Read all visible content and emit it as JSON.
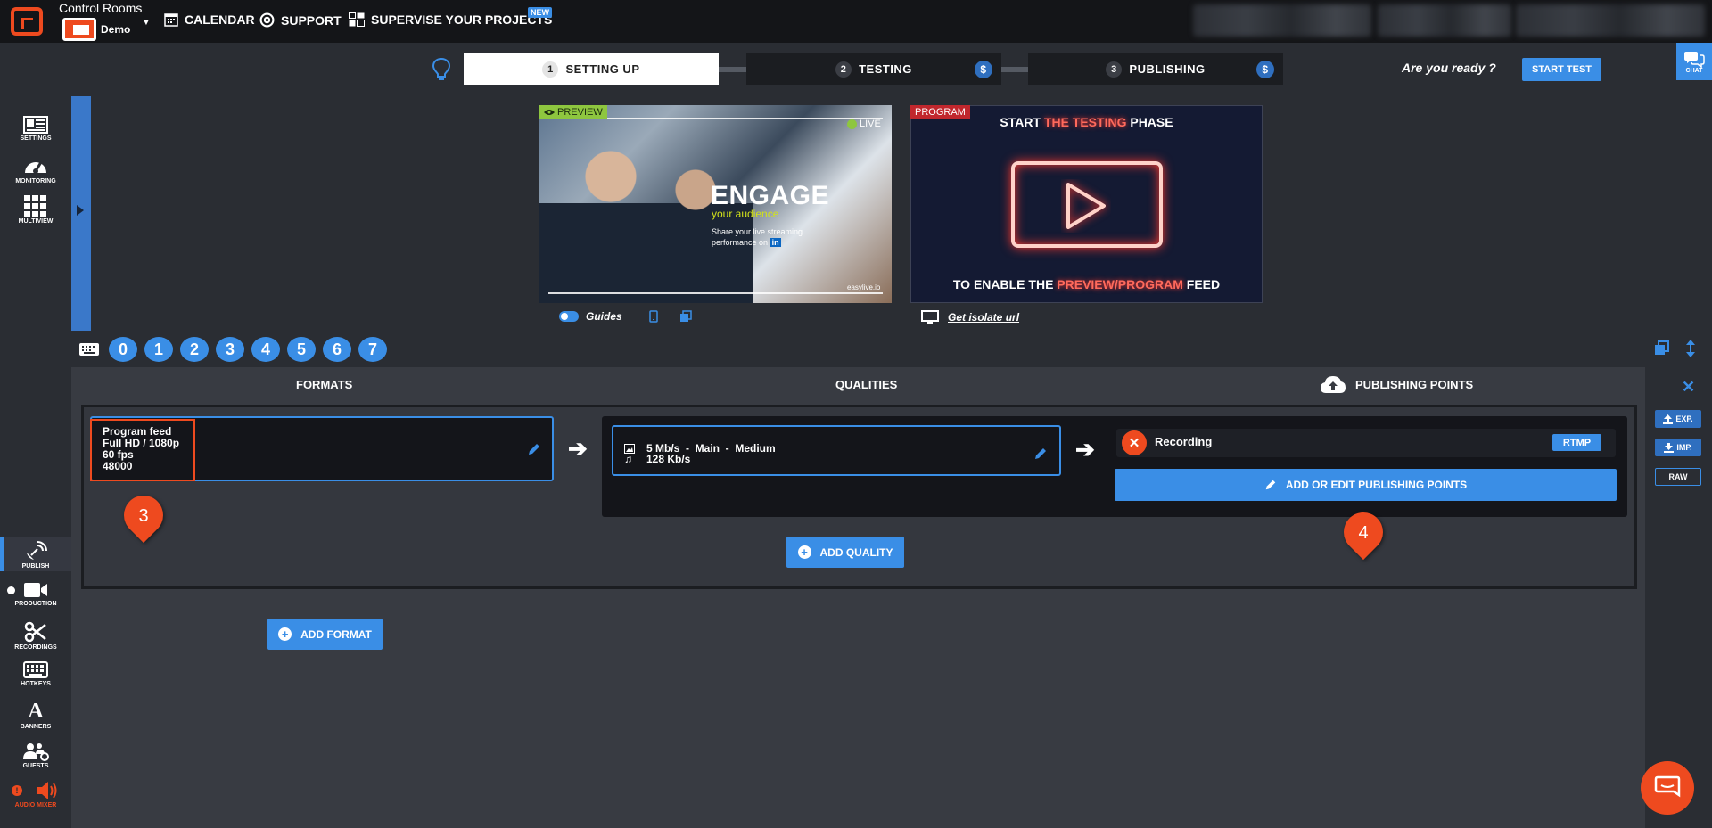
{
  "header": {
    "app_title": "Control Rooms",
    "project": "Demo",
    "nav": [
      {
        "label": "CALENDAR",
        "icon": "calendar-icon"
      },
      {
        "label": "SUPPORT",
        "icon": "lifebuoy-icon"
      },
      {
        "label": "SUPERVISE YOUR PROJECTS",
        "icon": "grid-icon"
      }
    ],
    "new_badge": "NEW"
  },
  "steps": [
    {
      "num": "1",
      "label": "SETTING UP",
      "active": true
    },
    {
      "num": "2",
      "label": "TESTING",
      "price": "$"
    },
    {
      "num": "3",
      "label": "PUBLISHING",
      "price": "$"
    }
  ],
  "ready_text": "Are you ready ?",
  "start_test_label": "START TEST",
  "chat_label": "CHAT",
  "sidebar_top": [
    {
      "label": "SETTINGS",
      "icon": "settings-icon"
    },
    {
      "label": "MONITORING",
      "icon": "gauge-icon"
    },
    {
      "label": "MULTIVIEW",
      "icon": "multiview-icon"
    }
  ],
  "sidebar_bottom": [
    {
      "label": "PUBLISH",
      "icon": "satellite-icon",
      "active": true
    },
    {
      "label": "PRODUCTION",
      "icon": "camera-icon"
    },
    {
      "label": "RECORDINGS",
      "icon": "scissors-icon"
    },
    {
      "label": "HOTKEYS",
      "icon": "keyboard-icon"
    },
    {
      "label": "BANNERS",
      "icon": "letter-a-icon"
    },
    {
      "label": "GUESTS",
      "icon": "guests-icon"
    },
    {
      "label": "AUDIO MIXER",
      "icon": "speaker-icon",
      "alert": true
    }
  ],
  "preview": {
    "tag": "PREVIEW",
    "live": "LIVE",
    "headline": "ENGAGE",
    "subhead": "your audience",
    "body": "Share your live streaming performance on",
    "linkedin": "in",
    "brand": "easylive.io"
  },
  "program": {
    "tag": "PROGRAM",
    "top_line_a": "START ",
    "top_line_b": "THE TESTING",
    "top_line_c": " PHASE",
    "bottom_line_a": "TO ENABLE THE ",
    "bottom_line_b": "PREVIEW/PROGRAM",
    "bottom_line_c": " FEED"
  },
  "guides_label": "Guides",
  "isolate_label": "Get isolate url",
  "hotkeys": [
    "0",
    "1",
    "2",
    "3",
    "4",
    "5",
    "6",
    "7"
  ],
  "columns": {
    "formats": "FORMATS",
    "qualities": "QUALITIES",
    "publishing_points": "PUBLISHING POINTS"
  },
  "format": {
    "name": "Program feed",
    "resolution": "Full HD / 1080p",
    "fps": "60 fps",
    "sample_rate": "48000"
  },
  "quality": {
    "video": "5 Mb/s  -  Main  -  Medium",
    "audio": "128 Kb/s"
  },
  "publishing_point": {
    "name": "Recording",
    "protocol": "RTMP"
  },
  "buttons": {
    "add_edit_pub": "ADD OR EDIT PUBLISHING POINTS",
    "add_quality": "ADD QUALITY",
    "add_format": "ADD FORMAT",
    "exp": "EXP.",
    "imp": "IMP.",
    "raw": "RAW"
  },
  "markers": [
    "3",
    "4"
  ],
  "colors": {
    "accent": "#3a8ee6",
    "brand": "#ee4a1f",
    "preview_tag": "#8ec63f",
    "program_tag": "#c1272d"
  }
}
